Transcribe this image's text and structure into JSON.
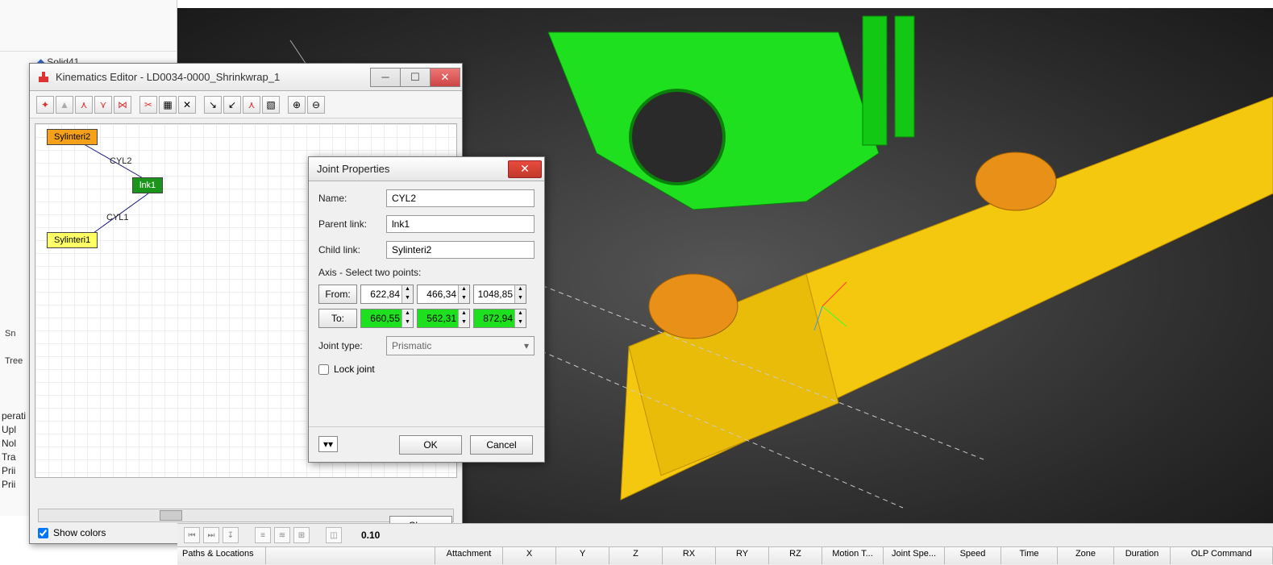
{
  "left": {
    "tree_item": "Solid41",
    "tab_sn": "Sn",
    "tab_tree": "Tree",
    "ops_header": "perati",
    "ops": [
      "Upl",
      "Nol",
      "Tra",
      "Prii",
      "Prii"
    ]
  },
  "kin": {
    "title": "Kinematics Editor -  LD0034-0000_Shrinkwrap_1",
    "nodes": {
      "syl2": "Sylinteri2",
      "lnk1": "lnk1",
      "syl1": "Sylinteri1"
    },
    "labels": {
      "cyl2": "CYL2",
      "cyl1": "CYL1"
    },
    "show_colors": "Show colors",
    "close": "Close"
  },
  "jd": {
    "title": "Joint Properties",
    "name_label": "Name:",
    "name": "CYL2",
    "parent_label": "Parent link:",
    "parent": "lnk1",
    "child_label": "Child link:",
    "child": "Sylinteri2",
    "axis_label": "Axis - Select two points:",
    "from_label": "From:",
    "from": [
      "622,84",
      "466,34",
      "1048,85"
    ],
    "to_label": "To:",
    "to": [
      "660,55",
      "562,31",
      "872,94"
    ],
    "jt_label": "Joint type:",
    "jt": "Prismatic",
    "lock": "Lock joint",
    "ok": "OK",
    "cancel": "Cancel"
  },
  "bottom": {
    "value": "0.10",
    "partial": "Paths & Locations",
    "headers": [
      "Attachment",
      "X",
      "Y",
      "Z",
      "RX",
      "RY",
      "RZ",
      "Motion T...",
      "Joint Spe...",
      "Speed",
      "Time",
      "Zone",
      "Duration",
      "OLP Command"
    ]
  }
}
